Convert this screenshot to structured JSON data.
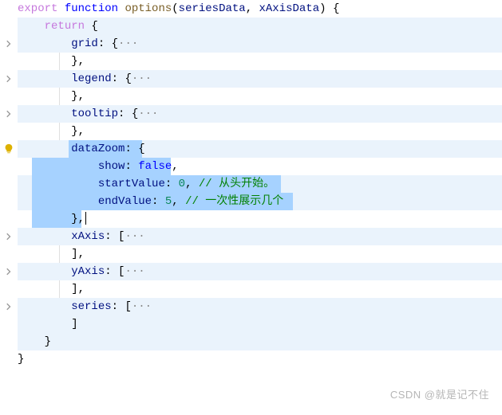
{
  "code": {
    "l1_export": "export",
    "l1_function": "function",
    "l1_name": "options",
    "l1_paren_open": "(",
    "l1_p1": "seriesData",
    "l1_comma": ", ",
    "l1_p2": "xAxisData",
    "l1_paren_close": ") ",
    "l1_brace": "{",
    "l2_return": "return",
    "l2_brace": " {",
    "grid_key": "grid",
    "legend_key": "legend",
    "tooltip_key": "tooltip",
    "dataZoom_key": "dataZoom",
    "xAxis_key": "xAxis",
    "yAxis_key": "yAxis",
    "series_key": "series",
    "colon_brace": ": {",
    "colon_bracket": ": [",
    "dots": "···",
    "close_brace_comma": "},",
    "close_bracket_comma": "],",
    "close_bracket": "]",
    "close_brace": "}",
    "show_key": "show",
    "show_val": "false",
    "startValue_key": "startValue",
    "startValue_val": "0",
    "startValue_comment": "// 从头开始。",
    "endValue_key": "endValue",
    "endValue_val": "5",
    "endValue_comment": "// 一次性展示几个",
    "comma": ",",
    "colon_sp": ": "
  },
  "watermark": "CSDN @就是记不住"
}
